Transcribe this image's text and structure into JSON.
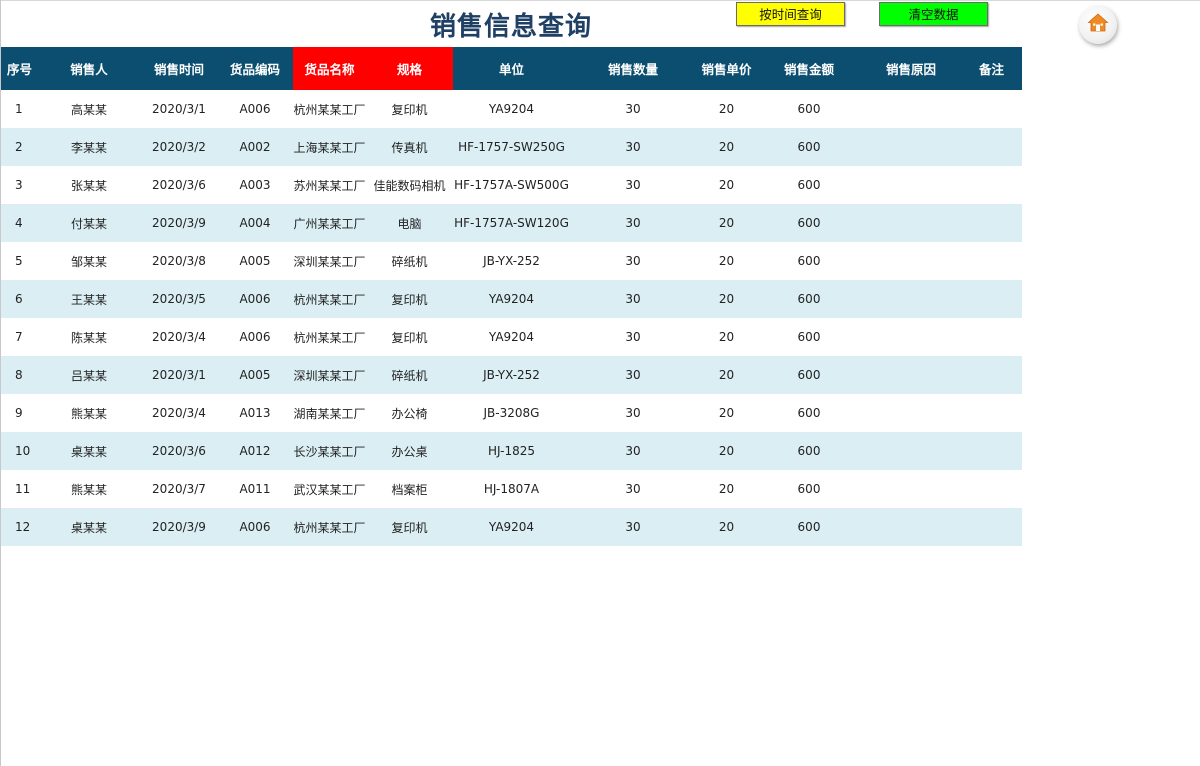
{
  "title": "销售信息查询",
  "buttons": {
    "query_by_time": "按时间查询",
    "clear_data": "清空数据"
  },
  "home_icon": "home-icon",
  "colors": {
    "header_bg": "#0b4e6f",
    "header_highlight": "#ff0000",
    "row_alt": "#daeef3",
    "btn_query": "#ffff00",
    "btn_clear": "#00ff00",
    "title": "#1f3f64"
  },
  "columns": [
    "序号",
    "销售人",
    "销售时间",
    "货品编码",
    "货品名称",
    "规格",
    "单位",
    "销售数量",
    "销售单价",
    "销售金额",
    "销售原因",
    "备注"
  ],
  "rows": [
    [
      "1",
      "高某某",
      "2020/3/1",
      "A006",
      "杭州某某工厂",
      "复印机",
      "YA9204",
      "30",
      "20",
      "600",
      "",
      ""
    ],
    [
      "2",
      "李某某",
      "2020/3/2",
      "A002",
      "上海某某工厂",
      "传真机",
      "HF-1757-SW250G",
      "30",
      "20",
      "600",
      "",
      ""
    ],
    [
      "3",
      "张某某",
      "2020/3/6",
      "A003",
      "苏州某某工厂",
      "佳能数码相机",
      "HF-1757A-SW500G",
      "30",
      "20",
      "600",
      "",
      ""
    ],
    [
      "4",
      "付某某",
      "2020/3/9",
      "A004",
      "广州某某工厂",
      "电脑",
      "HF-1757A-SW120G",
      "30",
      "20",
      "600",
      "",
      ""
    ],
    [
      "5",
      "邹某某",
      "2020/3/8",
      "A005",
      "深圳某某工厂",
      "碎纸机",
      "JB-YX-252",
      "30",
      "20",
      "600",
      "",
      ""
    ],
    [
      "6",
      "王某某",
      "2020/3/5",
      "A006",
      "杭州某某工厂",
      "复印机",
      "YA9204",
      "30",
      "20",
      "600",
      "",
      ""
    ],
    [
      "7",
      "陈某某",
      "2020/3/4",
      "A006",
      "杭州某某工厂",
      "复印机",
      "YA9204",
      "30",
      "20",
      "600",
      "",
      ""
    ],
    [
      "8",
      "吕某某",
      "2020/3/1",
      "A005",
      "深圳某某工厂",
      "碎纸机",
      "JB-YX-252",
      "30",
      "20",
      "600",
      "",
      ""
    ],
    [
      "9",
      "熊某某",
      "2020/3/4",
      "A013",
      "湖南某某工厂",
      "办公椅",
      "JB-3208G",
      "30",
      "20",
      "600",
      "",
      ""
    ],
    [
      "10",
      "桌某某",
      "2020/3/6",
      "A012",
      "长沙某某工厂",
      "办公桌",
      "HJ-1825",
      "30",
      "20",
      "600",
      "",
      ""
    ],
    [
      "11",
      "熊某某",
      "2020/3/7",
      "A011",
      "武汉某某工厂",
      "档案柜",
      "HJ-1807A",
      "30",
      "20",
      "600",
      "",
      ""
    ],
    [
      "12",
      "桌某某",
      "2020/3/9",
      "A006",
      "杭州某某工厂",
      "复印机",
      "YA9204",
      "30",
      "20",
      "600",
      "",
      ""
    ]
  ]
}
